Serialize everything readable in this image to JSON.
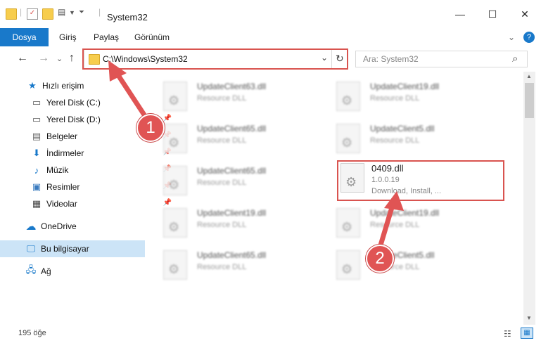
{
  "window": {
    "title": "System32",
    "minimize_glyph": "—",
    "maximize_glyph": "☐",
    "close_glyph": "✕"
  },
  "ribbon": {
    "tabs": [
      "Dosya",
      "Giriş",
      "Paylaş",
      "Görünüm"
    ],
    "active_tab": "Dosya",
    "active_color": "#1979ca",
    "expand_glyph": "⌄",
    "help_glyph": "?"
  },
  "address": {
    "path": "C:\\Windows\\System32",
    "search_placeholder": "Ara: System32",
    "refresh_glyph": "↻",
    "dropdown_glyph": "⌄",
    "search_icon_glyph": "⌕",
    "back_glyph": "←",
    "forward_glyph": "→",
    "recent_glyph": "⌄",
    "up_glyph": "↑"
  },
  "sidebar": {
    "quick_access": "Hızlı erişim",
    "items": [
      {
        "label": "Yerel Disk (C:)",
        "icon": "drive-icon",
        "glyph": "▭",
        "pinned": false
      },
      {
        "label": "Yerel Disk (D:)",
        "icon": "drive-icon",
        "glyph": "▭",
        "pinned": true
      },
      {
        "label": "Belgeler",
        "icon": "documents-icon",
        "glyph": "▤",
        "pinned": true
      },
      {
        "label": "İndirmeler",
        "icon": "download-icon",
        "glyph": "⬇",
        "pinned": true
      },
      {
        "label": "Müzik",
        "icon": "music-icon",
        "glyph": "♪",
        "pinned": true
      },
      {
        "label": "Resimler",
        "icon": "pictures-icon",
        "glyph": "▣",
        "pinned": true
      },
      {
        "label": "Videolar",
        "icon": "videos-icon",
        "glyph": "▦",
        "pinned": true
      }
    ],
    "onedrive": "OneDrive",
    "this_pc": "Bu bilgisayar",
    "network": "Ağ"
  },
  "files": {
    "left_column": [
      {
        "name": "UpdateClient63.dll",
        "desc": "Resource DLL"
      },
      {
        "name": "UpdateClient65.dll",
        "desc": "Resource DLL"
      },
      {
        "name": "UpdateClient65.dll",
        "desc": "Resource DLL"
      },
      {
        "name": "UpdateClient19.dll",
        "desc": "Resource DLL"
      },
      {
        "name": "UpdateClient65.dll",
        "desc": "Resource DLL"
      }
    ],
    "right_column": [
      {
        "name": "UpdateClient19.dll",
        "desc": "Resource DLL"
      },
      {
        "name": "UpdateClient5.dll",
        "desc": "Resource DLL"
      },
      {
        "name": "UpdateClient19.dll",
        "desc": "Resource DLL"
      },
      {
        "name": "UpdateClient5.dll",
        "desc": "Resource DLL"
      }
    ],
    "highlighted": {
      "name": "0409.dll",
      "version": "1.0.0.19",
      "desc": "Download, Install, ..."
    }
  },
  "status": {
    "count": "195 öğe"
  },
  "callouts": {
    "one": "1",
    "two": "2",
    "color": "#e05454"
  }
}
